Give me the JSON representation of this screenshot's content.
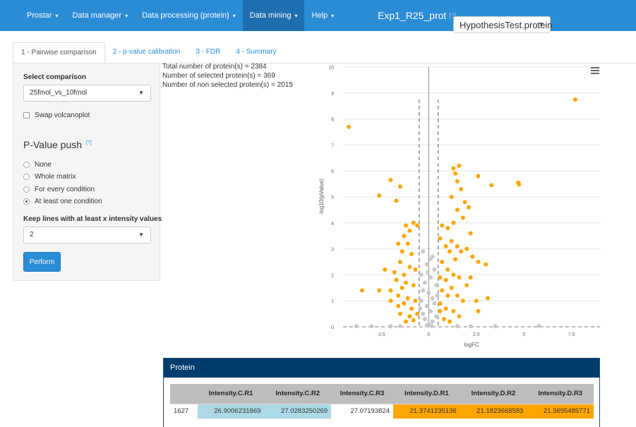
{
  "navbar": {
    "items": [
      {
        "label": "Prostar",
        "caret": "▾"
      },
      {
        "label": "Data manager",
        "caret": "▾"
      },
      {
        "label": "Data processing (protein)",
        "caret": "▾"
      },
      {
        "label": "Data mining",
        "caret": "▾"
      },
      {
        "label": "Help",
        "caret": "▾"
      }
    ],
    "active_item": "Data mining",
    "dataset_title": "Exp1_R25_prot",
    "dataset_help": "[?]",
    "object_select_value": "HypothesisTest.protein",
    "colors": {
      "bar": "#2b8cd6",
      "active": "#1f6fb0"
    }
  },
  "tabs": [
    {
      "label": "1 - Pairwise comparison",
      "active": true
    },
    {
      "label": "2 - p-value calibration",
      "active": false
    },
    {
      "label": "3 - FDR",
      "active": false
    },
    {
      "label": "4 - Summary",
      "active": false
    }
  ],
  "sidebar": {
    "comparison_label": "Select comparison",
    "comparison_value": "25fmol_vs_10fmol",
    "swap_label": "Swap volcanoplot",
    "pvalue_push_title": "P-Value push",
    "pvalue_push_help": "[?]",
    "radio_options": [
      {
        "label": "None",
        "selected": false
      },
      {
        "label": "Whole matrix",
        "selected": false
      },
      {
        "label": "For every condition",
        "selected": false
      },
      {
        "label": "At least one condition",
        "selected": true
      }
    ],
    "keep_lines_label": "Keep lines with at least x intensity values",
    "keep_lines_value": "2",
    "perform_label": "Perform"
  },
  "stats": {
    "total": "Total number of protein(s) = 2384",
    "selected": "Number of selected protein(s) = 369",
    "non_selected": "Number of non selected protein(s) = 2015"
  },
  "chart_data": {
    "type": "scatter",
    "title": "",
    "xlabel": "logFC",
    "ylabel": "-log10(pValue)",
    "xlim": [
      -4.5,
      9
    ],
    "ylim": [
      0,
      10
    ],
    "x_ticks": [
      -2.5,
      0,
      2.5,
      5,
      7.5
    ],
    "x_tick_labels": [
      "-2.5",
      "0",
      "2.5",
      "5",
      "7.5"
    ],
    "y_ticks": [
      0,
      1,
      2,
      3,
      4,
      5,
      6,
      7,
      8,
      9,
      10
    ],
    "y_tick_labels": [
      "0",
      "1",
      "2",
      "3",
      "4",
      "5",
      "6",
      "7",
      "8",
      "9",
      "10"
    ],
    "grid": true,
    "legend": "none",
    "threshold_logfc": [
      -0.5,
      0.5
    ],
    "threshold_pvalue": 0,
    "colors": {
      "selected": "#ffa500",
      "non_selected": "#c8c8c8"
    },
    "series": [
      {
        "values": [
          [
            7.7,
            8.75
          ],
          [
            -4.2,
            7.7
          ],
          [
            -2.0,
            5.65
          ],
          [
            -2.6,
            5.05
          ],
          [
            -1.5,
            5.4
          ],
          [
            -1.7,
            4.85
          ],
          [
            4.7,
            5.55
          ],
          [
            4.75,
            5.48
          ],
          [
            3.3,
            5.45
          ],
          [
            2.6,
            5.8
          ],
          [
            1.6,
            6.2
          ],
          [
            1.3,
            6.1
          ],
          [
            1.4,
            5.9
          ],
          [
            1.5,
            5.6
          ],
          [
            1.7,
            5.3
          ],
          [
            1.2,
            5.0
          ],
          [
            1.9,
            4.8
          ],
          [
            1.5,
            4.5
          ],
          [
            1.8,
            4.2
          ],
          [
            2.1,
            4.6
          ],
          [
            1.3,
            4.0
          ],
          [
            2.2,
            3.6
          ],
          [
            1.0,
            3.8
          ],
          [
            0.7,
            3.9
          ],
          [
            -0.8,
            4.0
          ],
          [
            -1.0,
            3.7
          ],
          [
            -1.3,
            3.5
          ],
          [
            -1.6,
            3.2
          ],
          [
            -0.6,
            3.9
          ],
          [
            -1.2,
            3.9
          ],
          [
            -1.4,
            2.9
          ],
          [
            -1.1,
            3.2
          ],
          [
            -0.9,
            2.8
          ],
          [
            -1.5,
            2.5
          ],
          [
            -1.0,
            2.3
          ],
          [
            -1.8,
            2.1
          ],
          [
            -1.3,
            2.0
          ],
          [
            -2.3,
            2.2
          ],
          [
            -1.7,
            1.8
          ],
          [
            -0.7,
            2.2
          ],
          [
            -1.2,
            1.7
          ],
          [
            -0.8,
            1.6
          ],
          [
            -1.4,
            1.5
          ],
          [
            -2.0,
            1.4
          ],
          [
            -2.6,
            1.4
          ],
          [
            -3.5,
            1.4
          ],
          [
            -1.6,
            1.2
          ],
          [
            -1.1,
            1.1
          ],
          [
            -0.7,
            1.0
          ],
          [
            -1.3,
            0.9
          ],
          [
            -0.9,
            0.7
          ],
          [
            -1.6,
            0.8
          ],
          [
            -2.0,
            1.0
          ],
          [
            -0.6,
            0.5
          ],
          [
            -1.0,
            0.4
          ],
          [
            -1.5,
            0.5
          ],
          [
            -0.8,
            0.25
          ],
          [
            -1.2,
            0.2
          ],
          [
            0.6,
            3.4
          ],
          [
            0.9,
            3.1
          ],
          [
            1.1,
            2.9
          ],
          [
            1.4,
            2.6
          ],
          [
            1.7,
            2.9
          ],
          [
            2.0,
            3.0
          ],
          [
            2.3,
            2.7
          ],
          [
            2.6,
            2.5
          ],
          [
            3.0,
            2.4
          ],
          [
            0.7,
            2.5
          ],
          [
            1.0,
            2.2
          ],
          [
            1.3,
            2.0
          ],
          [
            0.6,
            1.9
          ],
          [
            0.9,
            1.8
          ],
          [
            1.6,
            1.9
          ],
          [
            2.2,
            1.9
          ],
          [
            2.0,
            1.6
          ],
          [
            1.2,
            1.5
          ],
          [
            0.7,
            1.4
          ],
          [
            1.0,
            1.2
          ],
          [
            1.5,
            1.2
          ],
          [
            1.8,
            1.0
          ],
          [
            2.5,
            1.0
          ],
          [
            3.1,
            1.1
          ],
          [
            0.6,
            0.9
          ],
          [
            0.9,
            0.7
          ],
          [
            1.3,
            0.6
          ],
          [
            1.6,
            0.4
          ],
          [
            2.6,
            0.6
          ],
          [
            0.8,
            0.3
          ],
          [
            1.1,
            0.2
          ],
          [
            0.6,
            0.6
          ],
          [
            1.2,
            3.3
          ],
          [
            1.5,
            3.1
          ]
        ],
        "name": ""
      },
      {
        "values": [
          [
            -0.3,
            2.9
          ],
          [
            0.2,
            2.7
          ],
          [
            -0.1,
            2.4
          ],
          [
            0.3,
            2.2
          ],
          [
            -0.4,
            2.0
          ],
          [
            0.1,
            1.9
          ],
          [
            -0.2,
            1.7
          ],
          [
            0.4,
            1.6
          ],
          [
            -0.3,
            1.4
          ],
          [
            0.0,
            1.3
          ],
          [
            0.2,
            1.1
          ],
          [
            -0.4,
            1.0
          ],
          [
            0.3,
            0.9
          ],
          [
            -0.1,
            0.8
          ],
          [
            0.1,
            0.6
          ],
          [
            -0.3,
            0.5
          ],
          [
            0.4,
            0.4
          ],
          [
            -0.2,
            0.3
          ],
          [
            0.2,
            0.2
          ],
          [
            0.0,
            0.1
          ],
          [
            -0.1,
            0.05
          ],
          [
            0.15,
            0.03
          ],
          [
            -0.45,
            0.7
          ],
          [
            0.45,
            1.2
          ],
          [
            -0.05,
            2.1
          ],
          [
            0.05,
            2.6
          ],
          [
            -3.0,
            0.02
          ],
          [
            -2.0,
            0.02
          ],
          [
            -1.5,
            0.02
          ],
          [
            1.5,
            0.02
          ],
          [
            2.2,
            0.02
          ],
          [
            3.5,
            0.02
          ],
          [
            5.8,
            0.03
          ],
          [
            -3.8,
            0.02
          ]
        ],
        "name": ""
      }
    ]
  },
  "protein": {
    "panel_title": "Protein",
    "columns": [
      "",
      "Intensity.C.R1",
      "Intensity.C.R2",
      "Intensity.C.R3",
      "Intensity.D.R1",
      "Intensity.D.R2",
      "Intensity.D.R3"
    ],
    "rows": [
      [
        "1627",
        "26.9006231869",
        "27.0283250269",
        "27.07193824",
        "21.3741235136",
        "21.1823668583",
        "21.3695485771"
      ]
    ]
  }
}
